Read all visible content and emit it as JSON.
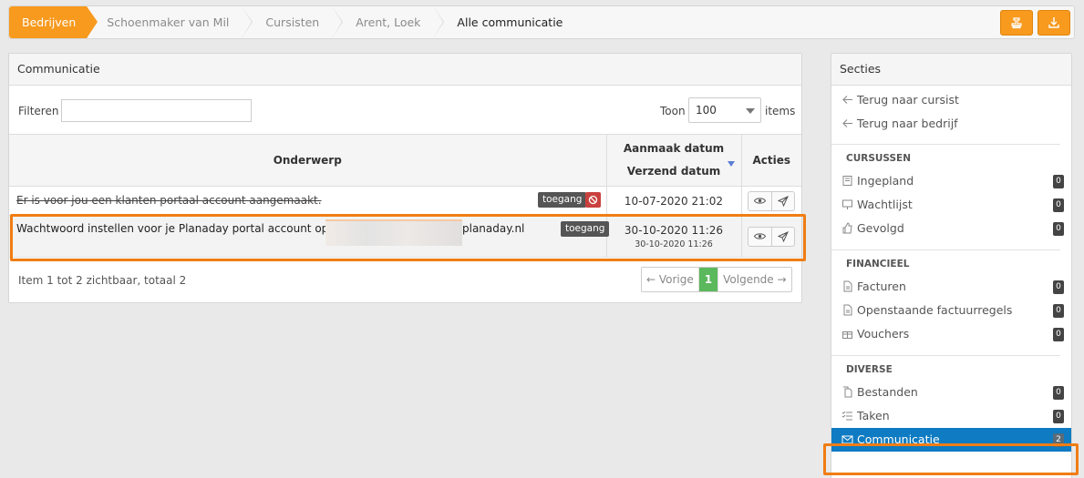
{
  "breadcrumb": [
    {
      "label": "Bedrijven"
    },
    {
      "label": "Schoenmaker van Mil"
    },
    {
      "label": "Cursisten"
    },
    {
      "label": "Arent, Loek"
    },
    {
      "label": "Alle communicatie"
    }
  ],
  "top_actions": [
    {
      "icon": "stamp-icon"
    },
    {
      "icon": "download-icon"
    }
  ],
  "communication_panel": {
    "title": "Communicatie",
    "filter_label": "Filteren",
    "filter_value": "",
    "show_label": "Toon",
    "page_size": "100",
    "items_label": "items",
    "columns": {
      "subject": "Onderwerp",
      "created": "Aanmaak datum",
      "sent": "Verzend datum",
      "actions": "Acties"
    },
    "rows": [
      {
        "subject": "Er is voor jou een klanten portaal account aangemaakt.",
        "badge": "toegang",
        "created": "10-07-2020 21:02",
        "sent": "",
        "struck": true
      },
      {
        "subject_prefix": "Wachtwoord instellen voor je Planaday portal account op h",
        "subject_suffix": "planaday.nl",
        "badge": "toegang",
        "created": "30-10-2020 11:26",
        "sent": "30-10-2020 11:26",
        "struck": false
      }
    ],
    "footer_text": "Item 1 tot 2 zichtbaar, totaal 2",
    "pager": {
      "prev": "← Vorige",
      "current": "1",
      "next": "Volgende →"
    }
  },
  "sections_panel": {
    "title": "Secties",
    "nav": [
      {
        "label": "Terug naar cursist"
      },
      {
        "label": "Terug naar bedrijf"
      }
    ],
    "groups": [
      {
        "title": "CURSUSSEN",
        "items": [
          {
            "label": "Ingepland",
            "count": "0",
            "icon": "book-icon"
          },
          {
            "label": "Wachtlijst",
            "count": "0",
            "icon": "presentation-icon"
          },
          {
            "label": "Gevolgd",
            "count": "0",
            "icon": "thumbs-up-icon"
          }
        ]
      },
      {
        "title": "FINANCIEEL",
        "items": [
          {
            "label": "Facturen",
            "count": "0",
            "icon": "file-icon"
          },
          {
            "label": "Openstaande factuurregels",
            "count": "0",
            "icon": "file-icon"
          },
          {
            "label": "Vouchers",
            "count": "0",
            "icon": "gift-icon"
          }
        ]
      },
      {
        "title": "DIVERSE",
        "items": [
          {
            "label": "Bestanden",
            "count": "0",
            "icon": "files-icon"
          },
          {
            "label": "Taken",
            "count": "0",
            "icon": "tasks-icon"
          },
          {
            "label": "Communicatie",
            "count": "2",
            "icon": "envelope-icon",
            "active": true
          }
        ]
      }
    ]
  },
  "colors": {
    "accent": "#f79a1e",
    "active": "#0e7bc2",
    "highlight": "#f07d14",
    "success": "#5cb85c"
  }
}
